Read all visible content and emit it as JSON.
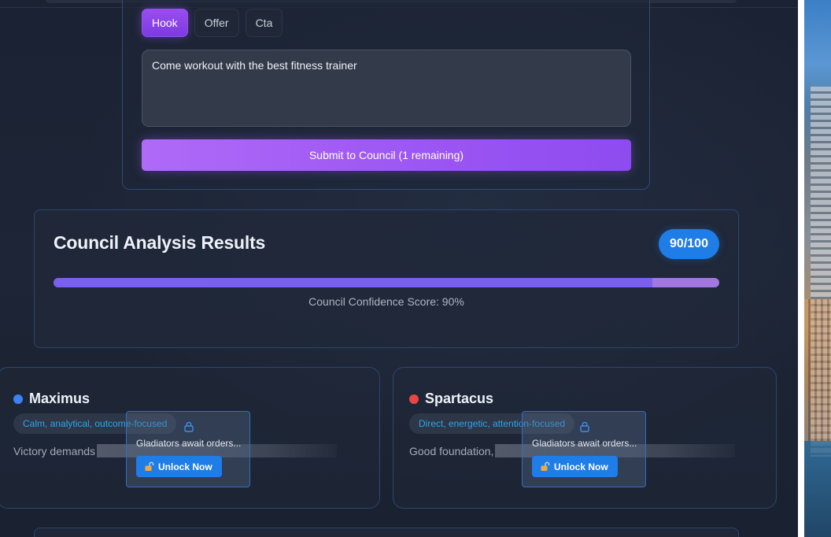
{
  "tabs": [
    {
      "label": "Hook",
      "active": true
    },
    {
      "label": "Offer",
      "active": false
    },
    {
      "label": "Cta",
      "active": false
    }
  ],
  "input": {
    "value": "Come workout with the best fitness trainer"
  },
  "submit_label": "Submit to Council (1 remaining)",
  "results": {
    "title": "Council Analysis Results",
    "score": "90/100",
    "confidence_fraction": 0.9,
    "confidence_label": "Council Confidence Score: 90%"
  },
  "council": [
    {
      "name": "Maximus",
      "dot_color": "#3b82f6",
      "trait": "Calm, analytical, outcome-focused",
      "snippet": "Victory demands",
      "lock_text": "Gladiators await orders...",
      "unlock_label": "Unlock Now"
    },
    {
      "name": "Spartacus",
      "dot_color": "#ef4444",
      "trait": "Direct, energetic, attention-focused",
      "snippet": "Good foundation,",
      "lock_text": "Gladiators await orders...",
      "unlock_label": "Unlock Now"
    }
  ],
  "colors": {
    "accent_purple": "#9b55f3",
    "accent_blue": "#1e7de6"
  }
}
